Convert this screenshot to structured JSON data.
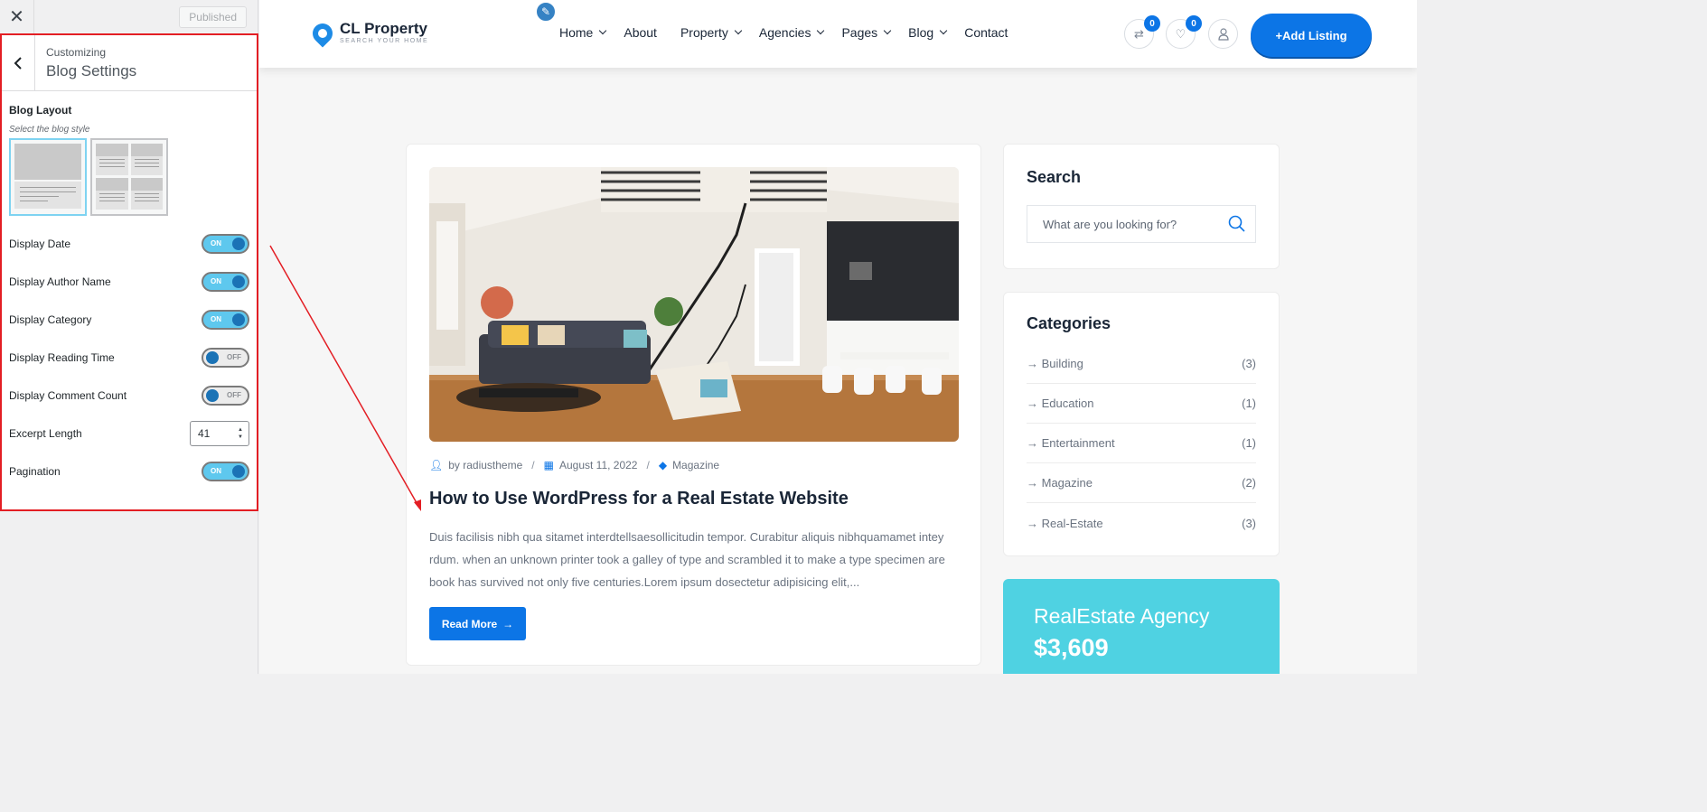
{
  "customizer": {
    "close_label": "✕",
    "published_label": "Published",
    "breadcrumb": "Customizing",
    "title": "Blog Settings",
    "blog_layout_label": "Blog Layout",
    "blog_layout_desc": "Select the blog style",
    "settings": [
      {
        "label": "Display Date",
        "state": "ON"
      },
      {
        "label": "Display Author Name",
        "state": "ON"
      },
      {
        "label": "Display Category",
        "state": "ON"
      },
      {
        "label": "Display Reading Time",
        "state": "OFF"
      },
      {
        "label": "Display Comment Count",
        "state": "OFF"
      }
    ],
    "excerpt_label": "Excerpt Length",
    "excerpt_value": "41",
    "pagination_label": "Pagination",
    "pagination_state": "ON"
  },
  "header": {
    "logo_name": "CL Property",
    "logo_tagline": "SEARCH YOUR HOME",
    "nav": [
      {
        "label": "Home",
        "dropdown": true
      },
      {
        "label": "About",
        "dropdown": false
      },
      {
        "label": "Property",
        "dropdown": true
      },
      {
        "label": "Agencies",
        "dropdown": true
      },
      {
        "label": "Pages",
        "dropdown": true
      },
      {
        "label": "Blog",
        "dropdown": true
      },
      {
        "label": "Contact",
        "dropdown": false
      }
    ],
    "compare_count": "0",
    "wishlist_count": "0",
    "add_listing": "+Add Listing"
  },
  "post": {
    "author": "by radiustheme",
    "date": "August 11, 2022",
    "category": "Magazine",
    "title": "How to Use WordPress for a Real Estate Website",
    "excerpt": "Duis facilisis nibh qua sitamet interdtellsaesollicitudin tempor. Curabitur aliquis nibhquamamet intey rdum. when an unknown printer took a galley of type and scrambled it to make a type specimen are book has survived not only five centuries.Lorem ipsum dosectetur adipisicing elit,...",
    "read_more": "Read More"
  },
  "sidebar": {
    "search_title": "Search",
    "search_placeholder": "What are you looking for?",
    "categories_title": "Categories",
    "categories": [
      {
        "name": "Building",
        "count": "(3)"
      },
      {
        "name": "Education",
        "count": "(1)"
      },
      {
        "name": "Entertainment",
        "count": "(1)"
      },
      {
        "name": "Magazine",
        "count": "(2)"
      },
      {
        "name": "Real-Estate",
        "count": "(3)"
      }
    ],
    "agency_name": "RealEstate Agency",
    "agency_price": "$3,609"
  },
  "colors": {
    "accent": "#0c75e6",
    "highlight_border": "#e31e24",
    "toggle_on": "#5ec8ee",
    "agency_bg": "#4fd2e2"
  }
}
